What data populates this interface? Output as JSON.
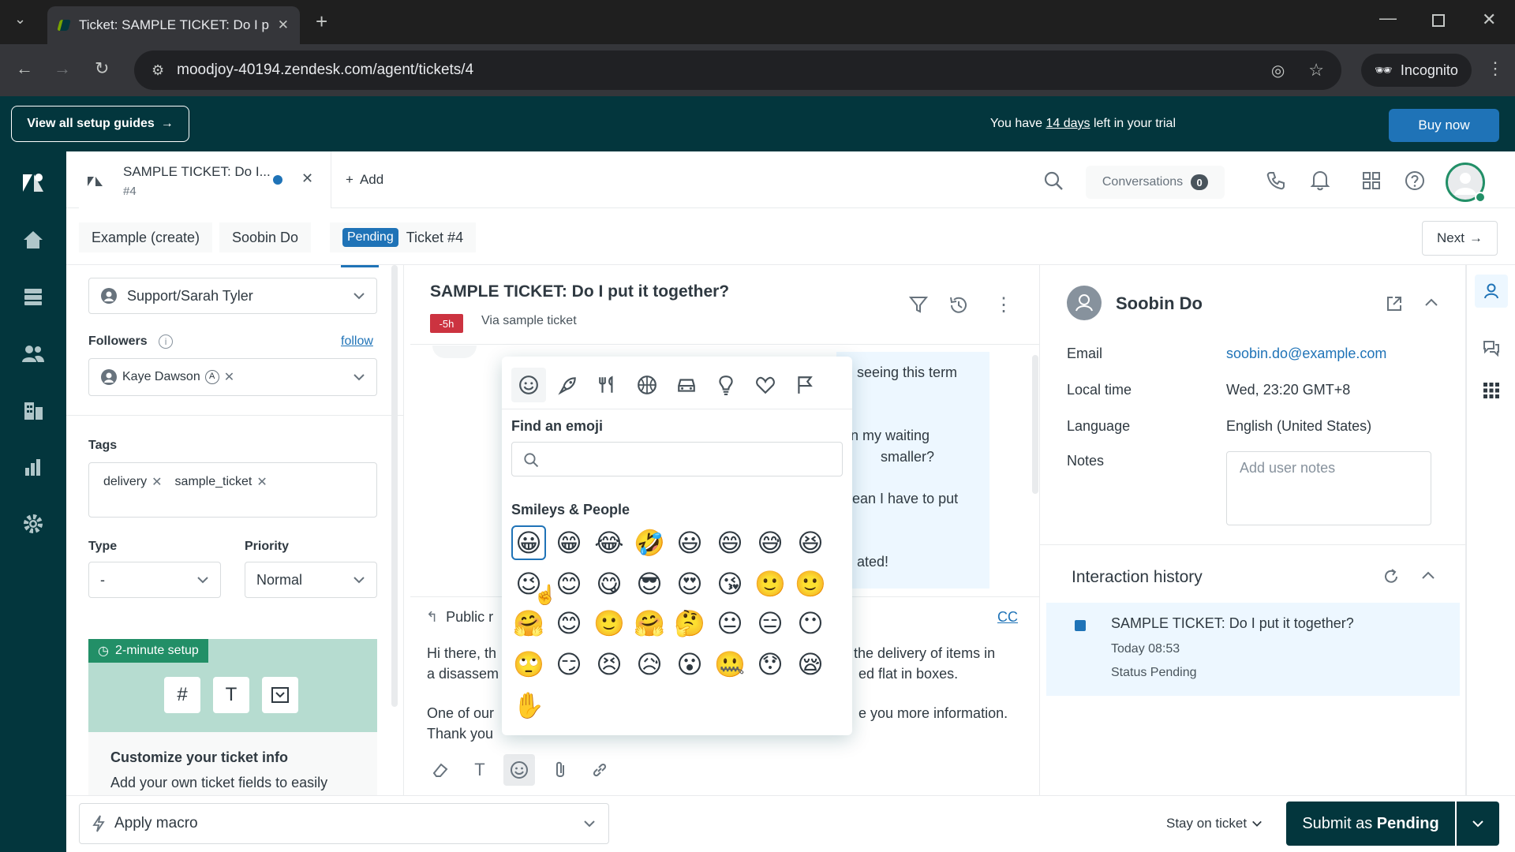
{
  "browser": {
    "tab_title": "Ticket: SAMPLE TICKET: Do I pu",
    "url": "moodjoy-40194.zendesk.com/agent/tickets/4",
    "incognito_label": "Incognito"
  },
  "banner": {
    "setup_guides": "View all setup guides",
    "trial_prefix": "You have ",
    "trial_days": "14 days",
    "trial_suffix": " left in your trial",
    "buy_now": "Buy now"
  },
  "header": {
    "ticket_tab_title": "SAMPLE TICKET: Do I...",
    "ticket_tab_number": "#4",
    "add_label": "Add",
    "conversations_label": "Conversations",
    "conversations_count": "0"
  },
  "breadcrumbs": {
    "item1": "Example (create)",
    "item2": "Soobin Do",
    "status": "Pending",
    "ticket": "Ticket #4",
    "next": "Next"
  },
  "properties": {
    "assignee_value": "Support/Sarah Tyler",
    "followers_label": "Followers",
    "follow_link": "follow",
    "follower_name": "Kaye Dawson",
    "tags_label": "Tags",
    "tags": [
      "delivery",
      "sample_ticket"
    ],
    "type_label": "Type",
    "type_value": "-",
    "priority_label": "Priority",
    "priority_value": "Normal",
    "setup_chip": "2-minute setup",
    "setup_title": "Customize your ticket info",
    "setup_desc": "Add your own ticket fields to easily"
  },
  "conversation": {
    "title": "SAMPLE TICKET: Do I put it together?",
    "age": "-5h",
    "via": "Via sample ticket",
    "msg_fragments": [
      "seeing this term",
      "n my waiting",
      "smaller?",
      "ean I have to put",
      "ated!"
    ],
    "public_reply": "Public r",
    "cc": "CC",
    "draft_lines": [
      "Hi there, th",
      "a disassem",
      "One of our",
      "Thank you"
    ],
    "draft_right_lines": [
      "the delivery of items in",
      "ed flat in boxes.",
      "e you more information."
    ]
  },
  "emoji_picker": {
    "find_label": "Find an emoji",
    "search_placeholder": "",
    "section_label": "Smileys & People",
    "categories": [
      "smiley-icon",
      "rocket-icon",
      "utensils-icon",
      "ball-icon",
      "car-icon",
      "bulb-icon",
      "heart-icon",
      "flag-icon"
    ],
    "rows": [
      [
        "😀",
        "😁",
        "😂",
        "🤣",
        "😃",
        "😄",
        "😅",
        "😆"
      ],
      [
        "😉",
        "😊",
        "😋",
        "😎",
        "😍",
        "😘",
        "🙂",
        "🙂"
      ],
      [
        "🤗",
        "😊",
        "🙂",
        "🤗",
        "🤔",
        "😐",
        "😑",
        "😶"
      ],
      [
        "🙄",
        "😏",
        "😣",
        "😥",
        "😮",
        "🤐",
        "😯",
        "😪"
      ],
      [
        "✋"
      ]
    ]
  },
  "customer": {
    "name": "Soobin Do",
    "email_label": "Email",
    "email": "soobin.do@example.com",
    "local_time_label": "Local time",
    "local_time": "Wed, 23:20 GMT+8",
    "language_label": "Language",
    "language": "English (United States)",
    "notes_label": "Notes",
    "notes_placeholder": "Add user notes",
    "history_title": "Interaction history",
    "history_item_title": "SAMPLE TICKET: Do I put it together?",
    "history_item_time": "Today 08:53",
    "history_item_status": "Status Pending"
  },
  "footer": {
    "apply_macro": "Apply macro",
    "stay_on_ticket": "Stay on ticket",
    "submit_prefix": "Submit as ",
    "submit_status": "Pending"
  },
  "colors": {
    "brand_dark": "#03363d",
    "accent_blue": "#1f73b7",
    "danger": "#cc3340"
  }
}
